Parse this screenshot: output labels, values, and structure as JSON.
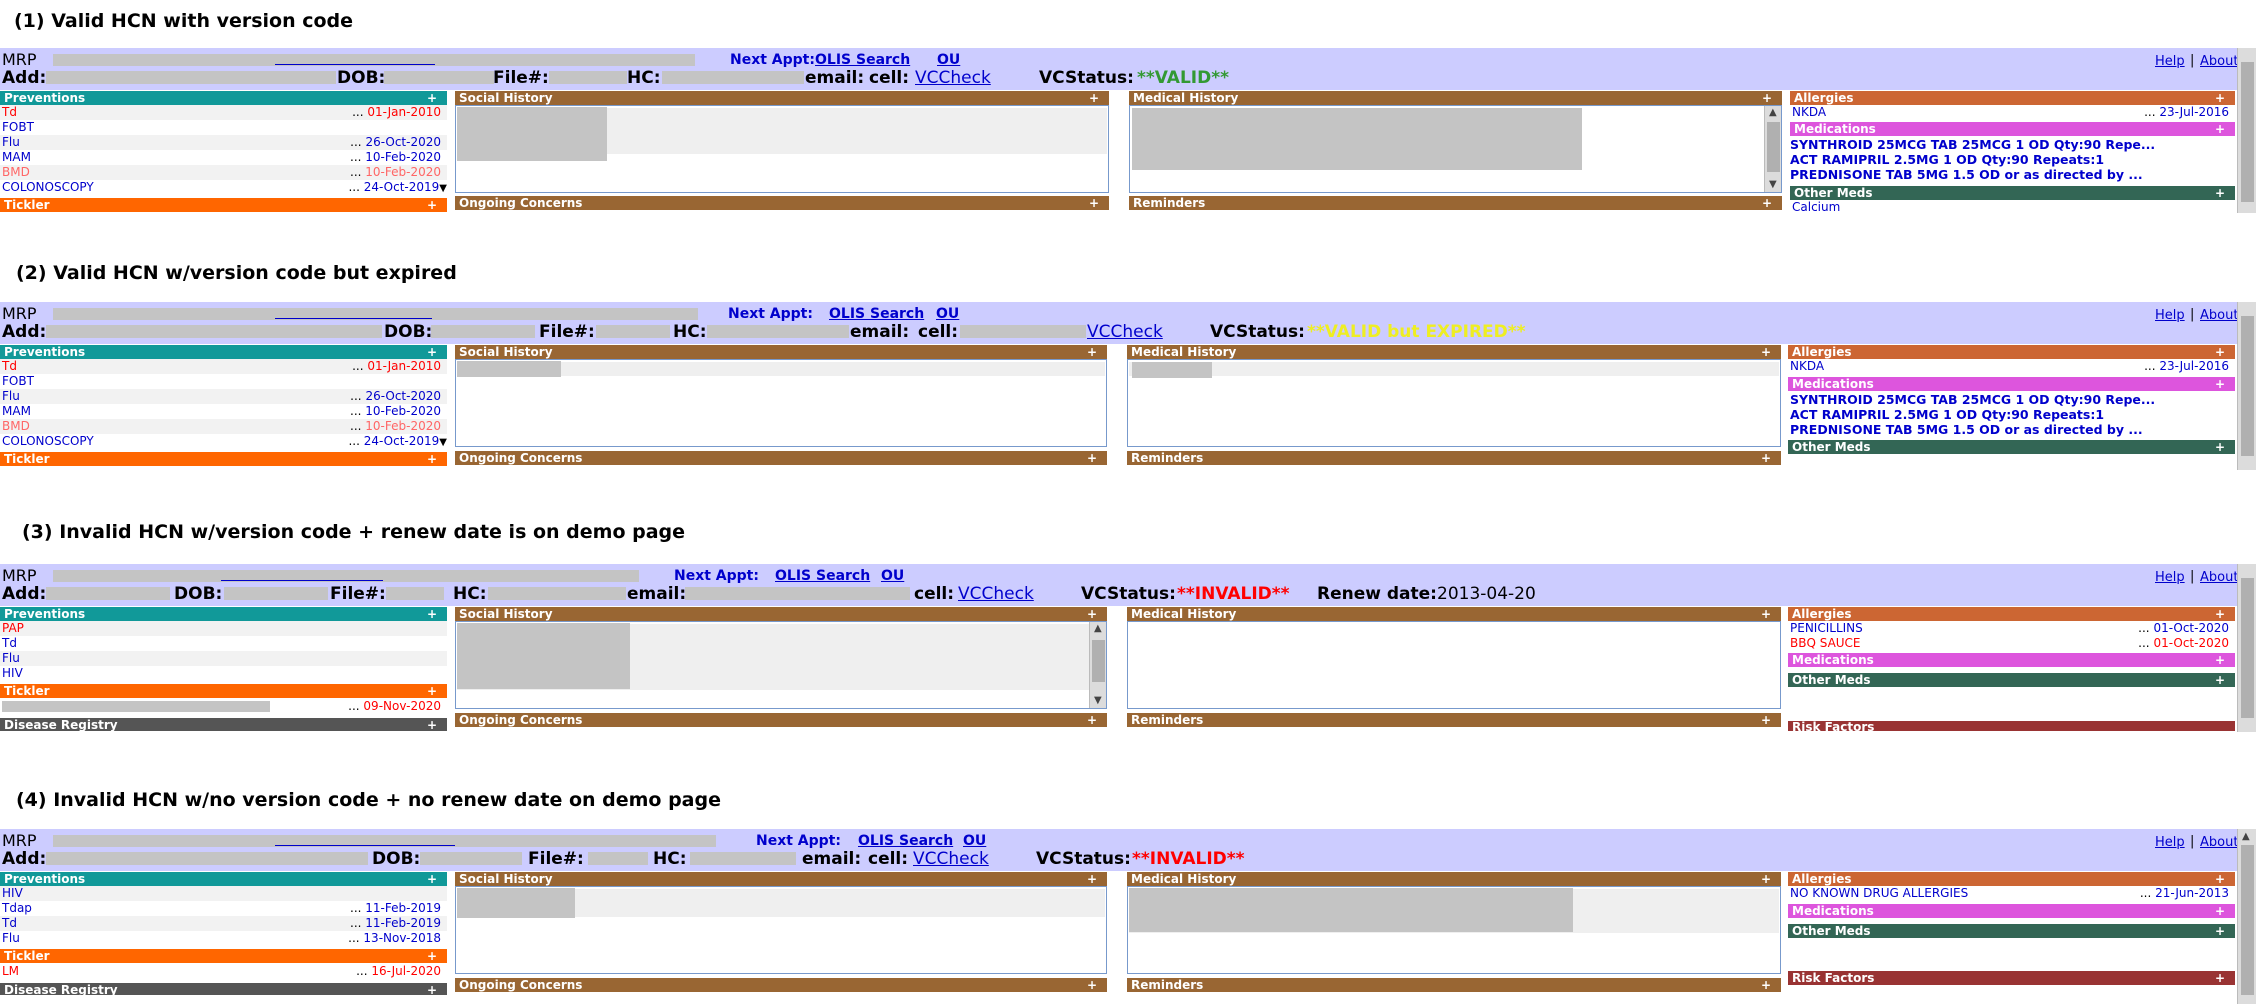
{
  "headings": {
    "s1": "(1) Valid HCN with version code",
    "s2": "(2) Valid HCN w/version code but expired",
    "s3": "(3) Invalid HCN w/version code + renew date is on demo page",
    "s4": "(4) Invalid HCN w/no version code + no renew date on demo page"
  },
  "common": {
    "mrp": "MRP",
    "next_appt": "Next Appt:",
    "olis": "OLIS Search",
    "ou": "OU",
    "help": "Help",
    "sep": "|",
    "about": "About",
    "add": "Add:",
    "dob": "DOB:",
    "file": "File#:",
    "hc": "HC:",
    "email": "email:",
    "cell": "cell:",
    "vccheck": "VCCheck",
    "vcstatus": "VCStatus:",
    "preventions": "Preventions",
    "tickler": "Tickler",
    "social": "Social History",
    "ongoing": "Ongoing Concerns",
    "medical": "Medical History",
    "reminders": "Reminders",
    "allergies": "Allergies",
    "medications": "Medications",
    "other_meds": "Other Meds",
    "risk": "Risk Factors",
    "disease": "Disease Registry",
    "plus": "+",
    "dots": "..."
  },
  "s1": {
    "vcstatus_value": "**VALID**",
    "preventions": [
      {
        "name": "Td",
        "date": "01-Jan-2010",
        "color": "red"
      },
      {
        "name": "FOBT",
        "date": "",
        "color": "blue"
      },
      {
        "name": "Flu",
        "date": "26-Oct-2020",
        "color": "blue"
      },
      {
        "name": "MAM",
        "date": "10-Feb-2020",
        "color": "blue"
      },
      {
        "name": "BMD",
        "date": "10-Feb-2020",
        "color": "salmon"
      },
      {
        "name": "COLONOSCOPY",
        "date": "24-Oct-2019",
        "color": "blue"
      }
    ],
    "allergy": {
      "name": "NKDA",
      "date": "23-Jul-2016"
    },
    "meds": [
      "SYNTHROID 25MCG TAB 25MCG 1 OD Qty:90 Repe...",
      "ACT RAMIPRIL 2.5MG 1 OD Qty:90 Repeats:1",
      "PREDNISONE TAB 5MG 1.5 OD or as directed by ..."
    ],
    "other_med": "Calcium"
  },
  "s2": {
    "vcstatus_value": "**VALID but EXPIRED**",
    "preventions": [
      {
        "name": "Td",
        "date": "01-Jan-2010",
        "color": "red"
      },
      {
        "name": "FOBT",
        "date": "",
        "color": "blue"
      },
      {
        "name": "Flu",
        "date": "26-Oct-2020",
        "color": "blue"
      },
      {
        "name": "MAM",
        "date": "10-Feb-2020",
        "color": "blue"
      },
      {
        "name": "BMD",
        "date": "10-Feb-2020",
        "color": "salmon"
      },
      {
        "name": "COLONOSCOPY",
        "date": "24-Oct-2019",
        "color": "blue"
      }
    ],
    "allergy": {
      "name": "NKDA",
      "date": "23-Jul-2016"
    },
    "meds": [
      "SYNTHROID 25MCG TAB 25MCG 1 OD Qty:90 Repe...",
      "ACT RAMIPRIL 2.5MG 1 OD Qty:90 Repeats:1",
      "PREDNISONE TAB 5MG 1.5 OD or as directed by ..."
    ]
  },
  "s3": {
    "vcstatus_value": "**INVALID**",
    "renew_label": "Renew date:",
    "renew_value": "2013-04-20",
    "preventions": [
      {
        "name": "PAP",
        "color": "red"
      },
      {
        "name": "Td",
        "color": "blue"
      },
      {
        "name": "Flu",
        "color": "blue"
      },
      {
        "name": "HIV",
        "color": "blue"
      }
    ],
    "tickler_date": "09-Nov-2020",
    "allergies": [
      {
        "name": "PENICILLINS",
        "date": "01-Oct-2020",
        "color": "blue"
      },
      {
        "name": "BBQ SAUCE",
        "date": "01-Oct-2020",
        "color": "red"
      }
    ]
  },
  "s4": {
    "vcstatus_value": "**INVALID**",
    "preventions": [
      {
        "name": "HIV",
        "date": "",
        "color": "blue"
      },
      {
        "name": "Tdap",
        "date": "11-Feb-2019",
        "color": "blue"
      },
      {
        "name": "Td",
        "date": "11-Feb-2019",
        "color": "blue"
      },
      {
        "name": "Flu",
        "date": "13-Nov-2018",
        "color": "blue"
      }
    ],
    "tickler": {
      "name": "LM",
      "date": "16-Jul-2020"
    },
    "allergy": {
      "name": "NO KNOWN DRUG ALLERGIES",
      "date": "21-Jun-2013"
    }
  }
}
